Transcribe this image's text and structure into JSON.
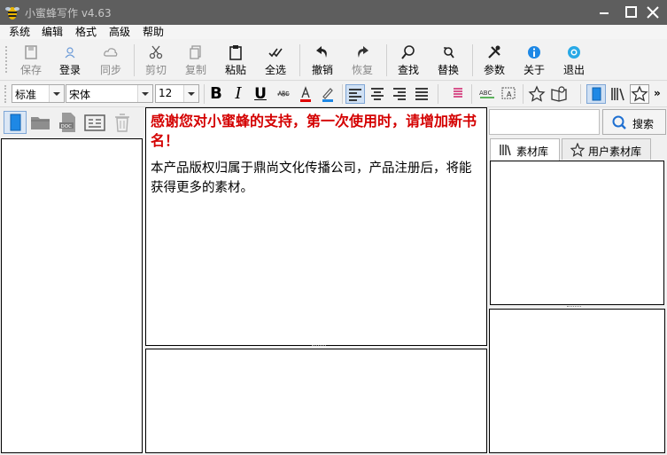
{
  "window": {
    "title": "小蜜蜂写作 v4.63"
  },
  "menu": [
    "系统",
    "编辑",
    "格式",
    "高级",
    "帮助"
  ],
  "toolbar": {
    "save": "保存",
    "login": "登录",
    "sync": "同步",
    "cut": "剪切",
    "copy": "复制",
    "paste": "粘贴",
    "select_all": "全选",
    "undo": "撤销",
    "redo": "恢复",
    "find": "查找",
    "replace": "替换",
    "settings": "参数",
    "about": "关于",
    "exit": "退出"
  },
  "format": {
    "style": "标准",
    "font": "宋体",
    "size": "12"
  },
  "editor": {
    "welcome": "感谢您对小蜜蜂的支持，第一次使用时，请增加新书名！",
    "body": "本产品版权归属于鼎尚文化传播公司，产品注册后，将能获得更多的素材。"
  },
  "search": {
    "button": "搜索",
    "value": ""
  },
  "tabs": {
    "material": "素材库",
    "user_material": "用户素材库"
  },
  "colors": {
    "titlebar": "#5e5e5e",
    "welcome_text": "#d40000",
    "accent": "#1e88e5"
  }
}
